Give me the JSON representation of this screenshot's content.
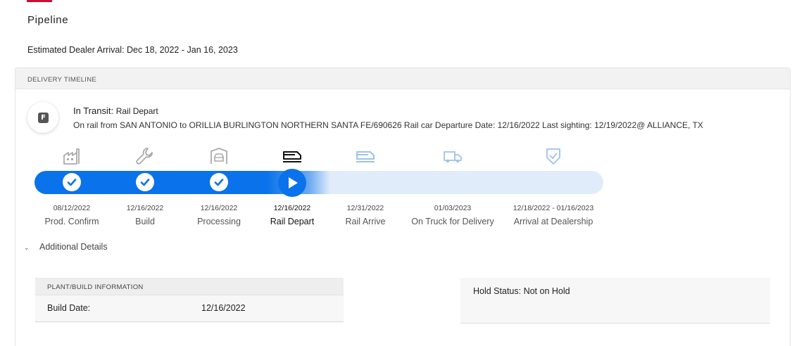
{
  "page": {
    "title": "Pipeline",
    "arrival_text": "Estimated Dealer Arrival: Dec 18, 2022 - Jan 16, 2023"
  },
  "timeline": {
    "header": "DELIVERY TIMELINE",
    "badge_letter": "F",
    "status_label": "In Transit:",
    "status_value": "Rail Depart",
    "detail": "On rail from SAN ANTONIO to ORILLIA BURLINGTON NORTHERN SANTA FE/690626 Rail car Departure Date: 12/16/2022 Last sighting: 12/19/2022@ ALLIANCE, TX",
    "progress_percent": 52,
    "stages": [
      {
        "label": "Prod. Confirm",
        "date": "08/12/2022",
        "state": "complete",
        "icon": "factory-icon"
      },
      {
        "label": "Build",
        "date": "12/16/2022",
        "state": "complete",
        "icon": "wrench-icon"
      },
      {
        "label": "Processing",
        "date": "12/16/2022",
        "state": "complete",
        "icon": "car-garage-icon"
      },
      {
        "label": "Rail Depart",
        "date": "12/16/2022",
        "state": "current",
        "icon": "train-icon"
      },
      {
        "label": "Rail Arrive",
        "date": "12/31/2022",
        "state": "upcoming",
        "icon": "train-icon"
      },
      {
        "label": "On Truck for Delivery",
        "date": "01/03/2023",
        "state": "upcoming",
        "icon": "truck-icon"
      },
      {
        "label": "Arrival at Dealership",
        "date": "12/18/2022 - 01/16/2023",
        "state": "upcoming",
        "icon": "shield-check-icon"
      }
    ],
    "colors": {
      "complete": "#0a72ea",
      "current": "#0a72ea",
      "upcoming": "#e1ecfb",
      "upcoming_icon": "#9cc3ec",
      "complete_icon": "#aaaaaa"
    }
  },
  "details": {
    "toggle_label": "Additional Details",
    "plant": {
      "header": "PLANT/BUILD INFORMATION",
      "build_date_label": "Build Date:",
      "build_date_value": "12/16/2022"
    },
    "hold_status": "Hold Status: Not on Hold"
  }
}
